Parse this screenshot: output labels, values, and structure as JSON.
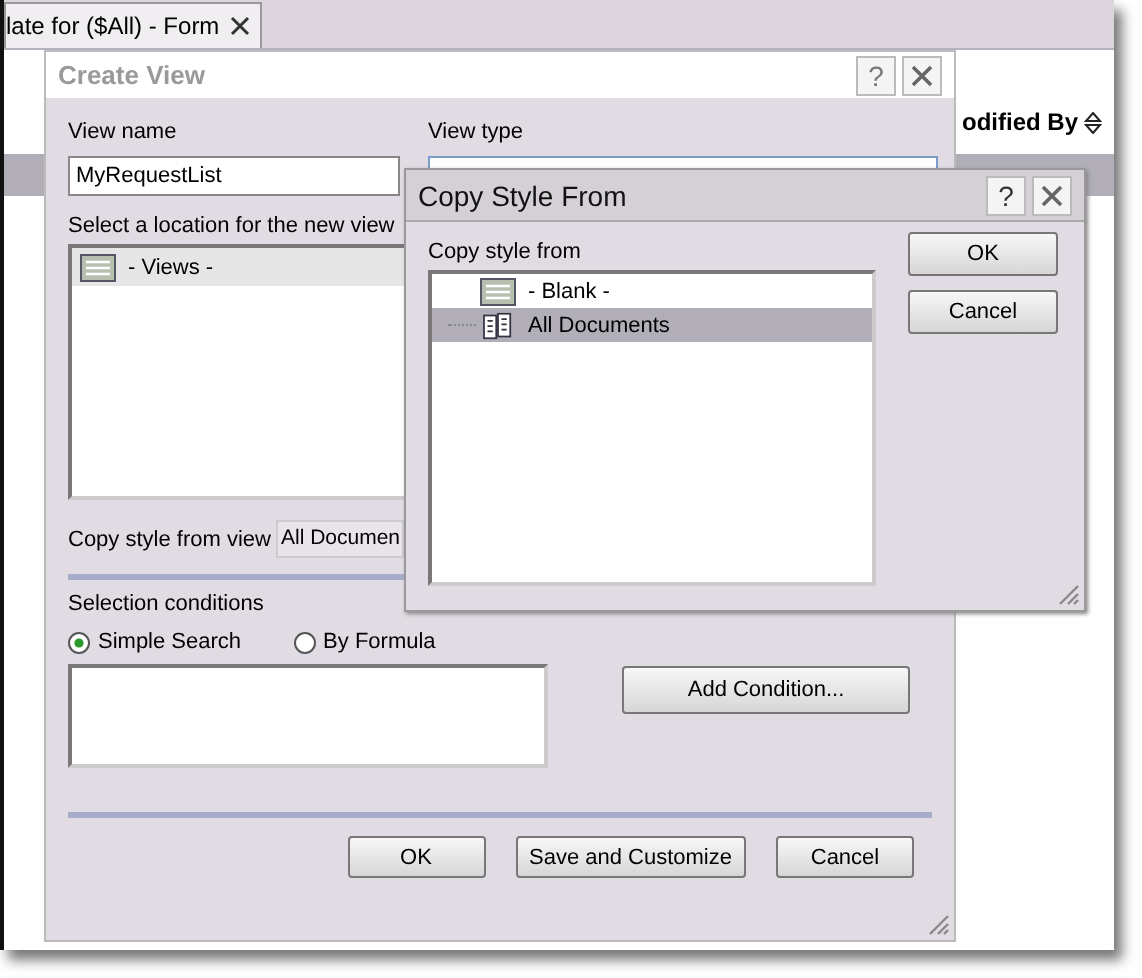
{
  "background": {
    "tab": {
      "title": "late for ($All) - Form"
    },
    "column_header": "odified By"
  },
  "create_view": {
    "title": "Create View",
    "help": "?",
    "view_name": {
      "label": "View name",
      "value": "MyRequestList"
    },
    "view_type": {
      "label": "View type"
    },
    "location": {
      "label": "Select a location for the new view",
      "items": [
        {
          "label": "- Views -",
          "selected": true
        }
      ]
    },
    "copy_style": {
      "label": "Copy style from view",
      "value": "All Documen"
    },
    "selection": {
      "label": "Selection conditions",
      "options": [
        {
          "label": "Simple Search",
          "selected": true
        },
        {
          "label": "By Formula",
          "selected": false
        }
      ],
      "add_button": "Add Condition..."
    },
    "buttons": [
      "OK",
      "Save and Customize",
      "Cancel"
    ]
  },
  "copy_style_dialog": {
    "title": "Copy Style From",
    "help": "?",
    "list_label": "Copy style from",
    "items": [
      {
        "label": "- Blank -",
        "kind": "blank",
        "selected": false
      },
      {
        "label": "All Documents",
        "kind": "view",
        "selected": true
      }
    ],
    "buttons": [
      "OK",
      "Cancel"
    ]
  }
}
